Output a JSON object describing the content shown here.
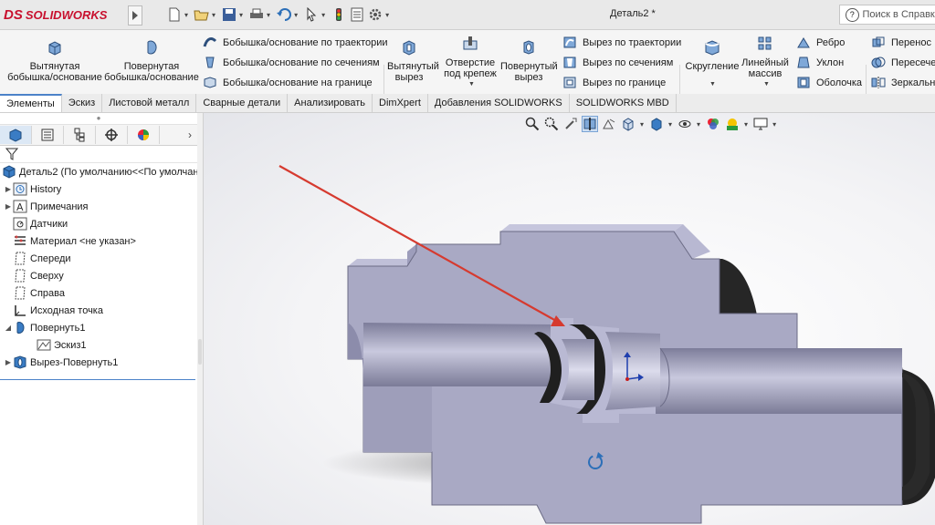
{
  "app": {
    "logo_ds": "DS",
    "logo_text": "SOLIDWORKS",
    "document_title": "Деталь2 *",
    "search_placeholder": "Поиск в Справке"
  },
  "quick_access": {
    "icons": [
      "new-document-icon",
      "open-icon",
      "save-icon",
      "print-icon",
      "undo-icon",
      "select-icon",
      "rebuild-icon",
      "file-properties-icon",
      "options-icon"
    ]
  },
  "ribbon": {
    "extruded_boss": "Вытянутая\nбобышка/основание",
    "revolved_boss": "Повернутая\nбобышка/основание",
    "swept_boss": "Бобышка/основание по траектории",
    "lofted_boss": "Бобышка/основание по сечениям",
    "boundary_boss": "Бобышка/основание на границе",
    "extruded_cut": "Вытянутый\nвырез",
    "hole_wizard": "Отверстие\nпод крепеж",
    "revolved_cut": "Повернутый\nвырез",
    "swept_cut": "Вырез по траектории",
    "lofted_cut": "Вырез по сечениям",
    "boundary_cut": "Вырез по границе",
    "fillet": "Скругление",
    "linear_pattern": "Линейный\nмассив",
    "rib": "Ребро",
    "draft": "Уклон",
    "shell": "Оболочка",
    "move": "Перенос",
    "intersect": "Пересечен",
    "mirror": "Зеркально"
  },
  "tabs": [
    "Элементы",
    "Эскиз",
    "Листовой металл",
    "Сварные детали",
    "Анализировать",
    "DimXpert",
    "Добавления SOLIDWORKS",
    "SOLIDWORKS MBD"
  ],
  "feature_manager": {
    "part": "Деталь2  (По умолчанию<<По умолчан",
    "items": [
      {
        "label": "History",
        "icon": "history-icon",
        "expandable": true
      },
      {
        "label": "Примечания",
        "icon": "annotations-icon",
        "expandable": true
      },
      {
        "label": "Датчики",
        "icon": "sensors-icon",
        "expandable": false
      },
      {
        "label": "Материал <не указан>",
        "icon": "material-icon",
        "expandable": false
      },
      {
        "label": "Спереди",
        "icon": "plane-icon",
        "expandable": false
      },
      {
        "label": "Сверху",
        "icon": "plane-icon",
        "expandable": false
      },
      {
        "label": "Справа",
        "icon": "plane-icon",
        "expandable": false
      },
      {
        "label": "Исходная точка",
        "icon": "origin-icon",
        "expandable": false
      },
      {
        "label": "Повернуть1",
        "icon": "revolve-feature-icon",
        "expandable": true,
        "expanded": true
      },
      {
        "label": "Эскиз1",
        "icon": "sketch-icon",
        "child": true
      },
      {
        "label": "Вырез-Повернуть1",
        "icon": "revolved-cut-feature-icon",
        "expandable": true
      }
    ]
  },
  "colors": {
    "accent": "#4b82c8",
    "model_face": "#a9a9c4",
    "model_dark": "#2a2a2a",
    "arrow": "#d63a2f",
    "logo_red": "#c8102e"
  }
}
